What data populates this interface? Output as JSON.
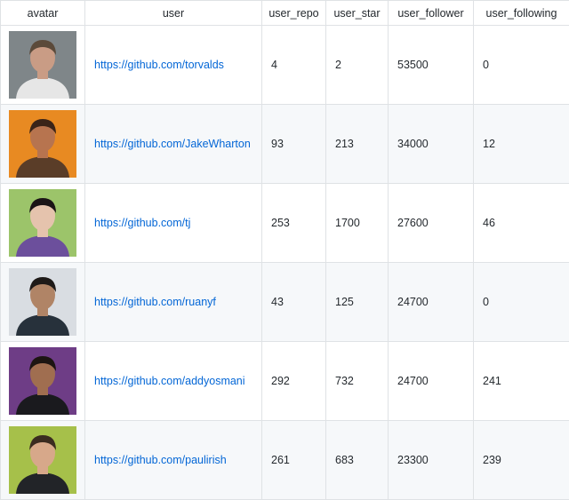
{
  "columns": [
    "avatar",
    "user",
    "user_repo",
    "user_star",
    "user_follower",
    "user_following"
  ],
  "rows": [
    {
      "user": "https://github.com/torvalds",
      "repo": "4",
      "star": "2",
      "follower": "53500",
      "following": "0",
      "avatar_icon": "person-photo",
      "bg": "#7f8689",
      "skin": "#c99c85",
      "hair": "#5b4a3a",
      "shirt": "#e6e6e6"
    },
    {
      "user": "https://github.com/JakeWharton",
      "repo": "93",
      "star": "213",
      "follower": "34000",
      "following": "12",
      "avatar_icon": "person-photo",
      "bg": "#e88a22",
      "skin": "#b7744f",
      "hair": "#3a2418",
      "shirt": "#5a3d28"
    },
    {
      "user": "https://github.com/tj",
      "repo": "253",
      "star": "1700",
      "follower": "27600",
      "following": "46",
      "avatar_icon": "person-photo",
      "bg": "#9cc46a",
      "skin": "#e5c3ad",
      "hair": "#1b1416",
      "shirt": "#6c4f9c"
    },
    {
      "user": "https://github.com/ruanyf",
      "repo": "43",
      "star": "125",
      "follower": "24700",
      "following": "0",
      "avatar_icon": "person-photo",
      "bg": "#d9dde2",
      "skin": "#b08466",
      "hair": "#1e1a18",
      "shirt": "#27313b"
    },
    {
      "user": "https://github.com/addyosmani",
      "repo": "292",
      "star": "732",
      "follower": "24700",
      "following": "241",
      "avatar_icon": "person-photo",
      "bg": "#6e3d86",
      "skin": "#a06e50",
      "hair": "#1c1512",
      "shirt": "#1a1a1e"
    },
    {
      "user": "https://github.com/paulirish",
      "repo": "261",
      "star": "683",
      "follower": "23300",
      "following": "239",
      "avatar_icon": "person-photo",
      "bg": "#a6c04a",
      "skin": "#d7a88a",
      "hair": "#3a2b20",
      "shirt": "#222428"
    }
  ]
}
